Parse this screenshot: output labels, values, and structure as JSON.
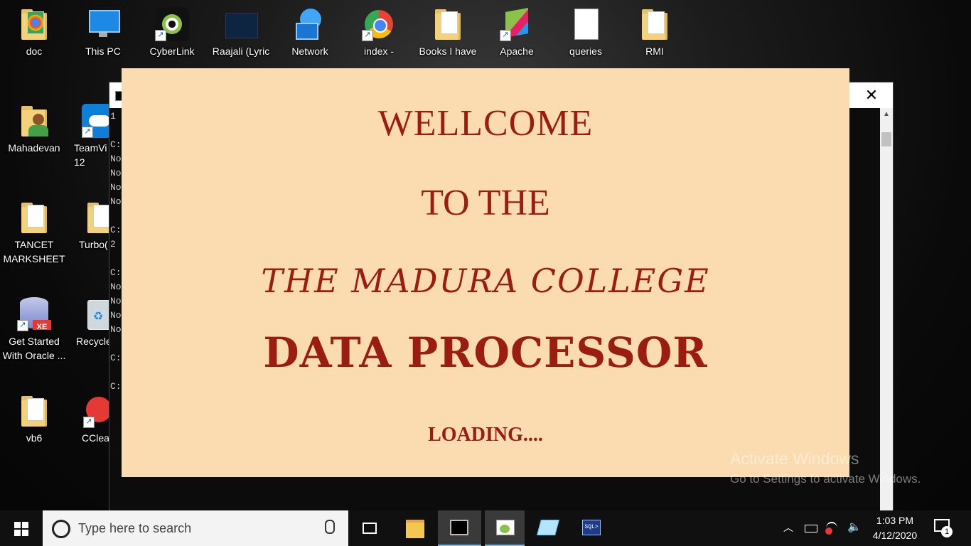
{
  "desktop": {
    "icons": [
      {
        "label": "doc"
      },
      {
        "label": "This PC"
      },
      {
        "label": "CyberLink"
      },
      {
        "label": "Raajali (Lyric"
      },
      {
        "label": "Network"
      },
      {
        "label": "index -"
      },
      {
        "label": "Books I have"
      },
      {
        "label": "Apache"
      },
      {
        "label": "queries"
      },
      {
        "label": "RMI"
      },
      {
        "label": "Mahadevan"
      },
      {
        "label": "TeamVi 12"
      },
      {
        "label": "TANCET MARKSHEET"
      },
      {
        "label": "Turbo("
      },
      {
        "label": "Get Started With Oracle ..."
      },
      {
        "label": "Recycle"
      },
      {
        "label": "vb6"
      },
      {
        "label": "CClea"
      }
    ]
  },
  "cmd_window": {
    "close_label": "✕",
    "visible_text": "1\n\nC:\nNo\nNo\nNo\nNo\n\nC:\n2\n\nC:\nNo\nNo\nNo\nNo\n\nC:\n\nC:"
  },
  "splash": {
    "line1": "WELLCOME",
    "line2": "TO THE",
    "line3": "THE MADURA COLLEGE",
    "line4": "DATA PROCESSOR",
    "loading": "LOADING....",
    "background_color": "#fbdcb0",
    "text_color": "#9b1c10"
  },
  "watermark": {
    "title": "Activate Windows",
    "subtitle": "Go to Settings to activate Windows."
  },
  "taskbar": {
    "search_placeholder": "Type here to search",
    "apps": [
      "task-view",
      "file-explorer",
      "command-prompt",
      "notepad-plus",
      "notes-app",
      "sql-plus"
    ],
    "time": "1:03 PM",
    "date": "4/12/2020",
    "notification_count": "1"
  }
}
